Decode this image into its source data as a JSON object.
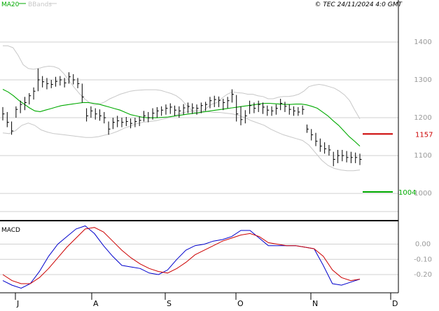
{
  "legend": {
    "ma20": "MA20",
    "bbands": "BBands"
  },
  "credit": "© TEC 24/11/2024 4:0 GMT",
  "colors": {
    "ma20": "#00aa00",
    "bbands": "#c8c8c8",
    "bars": "#000000",
    "grid": "#d0d0d0",
    "resistance": "#cc0000",
    "support": "#00aa00",
    "macd": "#0000cc",
    "signal": "#cc0000"
  },
  "chart_data": [
    {
      "type": "ohlc",
      "title": "",
      "legend": [
        "MA20",
        "BBands"
      ],
      "legend_placement": "top-left",
      "grid": true,
      "x_months": [
        "J",
        "A",
        "S",
        "O",
        "N",
        "D"
      ],
      "ylim": [
        930,
        1485
      ],
      "yticks": [
        1000,
        1100,
        1200,
        1300,
        1400
      ],
      "ytick_labels": [
        "1000",
        "1100",
        "1200",
        "1300",
        "1400"
      ],
      "levels": [
        {
          "name": "resistance",
          "value": 1157,
          "label": "1157"
        },
        {
          "name": "support",
          "value": 1004,
          "label": "1004"
        }
      ],
      "bars": [
        {
          "h": 1228,
          "l": 1193,
          "c": 1210
        },
        {
          "h": 1215,
          "l": 1175,
          "c": 1188
        },
        {
          "h": 1190,
          "l": 1155,
          "c": 1165
        },
        {
          "h": 1230,
          "l": 1200,
          "c": 1222
        },
        {
          "h": 1245,
          "l": 1212,
          "c": 1235
        },
        {
          "h": 1255,
          "l": 1220,
          "c": 1240
        },
        {
          "h": 1265,
          "l": 1235,
          "c": 1258
        },
        {
          "h": 1280,
          "l": 1248,
          "c": 1270
        },
        {
          "h": 1330,
          "l": 1270,
          "c": 1300
        },
        {
          "h": 1310,
          "l": 1280,
          "c": 1295
        },
        {
          "h": 1305,
          "l": 1275,
          "c": 1290
        },
        {
          "h": 1300,
          "l": 1278,
          "c": 1288
        },
        {
          "h": 1308,
          "l": 1282,
          "c": 1296
        },
        {
          "h": 1310,
          "l": 1285,
          "c": 1300
        },
        {
          "h": 1305,
          "l": 1280,
          "c": 1292
        },
        {
          "h": 1320,
          "l": 1290,
          "c": 1308
        },
        {
          "h": 1315,
          "l": 1288,
          "c": 1300
        },
        {
          "h": 1305,
          "l": 1278,
          "c": 1290
        },
        {
          "h": 1290,
          "l": 1240,
          "c": 1255
        },
        {
          "h": 1225,
          "l": 1190,
          "c": 1205
        },
        {
          "h": 1230,
          "l": 1200,
          "c": 1218
        },
        {
          "h": 1225,
          "l": 1195,
          "c": 1210
        },
        {
          "h": 1222,
          "l": 1192,
          "c": 1205
        },
        {
          "h": 1215,
          "l": 1185,
          "c": 1200
        },
        {
          "h": 1190,
          "l": 1155,
          "c": 1170
        },
        {
          "h": 1200,
          "l": 1170,
          "c": 1188
        },
        {
          "h": 1205,
          "l": 1175,
          "c": 1192
        },
        {
          "h": 1200,
          "l": 1175,
          "c": 1188
        },
        {
          "h": 1202,
          "l": 1178,
          "c": 1190
        },
        {
          "h": 1198,
          "l": 1172,
          "c": 1185
        },
        {
          "h": 1200,
          "l": 1175,
          "c": 1190
        },
        {
          "h": 1203,
          "l": 1178,
          "c": 1193
        },
        {
          "h": 1218,
          "l": 1190,
          "c": 1205
        },
        {
          "h": 1215,
          "l": 1188,
          "c": 1200
        },
        {
          "h": 1225,
          "l": 1195,
          "c": 1212
        },
        {
          "h": 1228,
          "l": 1200,
          "c": 1218
        },
        {
          "h": 1230,
          "l": 1205,
          "c": 1220
        },
        {
          "h": 1235,
          "l": 1208,
          "c": 1225
        },
        {
          "h": 1238,
          "l": 1210,
          "c": 1228
        },
        {
          "h": 1232,
          "l": 1205,
          "c": 1220
        },
        {
          "h": 1230,
          "l": 1200,
          "c": 1218
        },
        {
          "h": 1236,
          "l": 1208,
          "c": 1226
        },
        {
          "h": 1240,
          "l": 1212,
          "c": 1230
        },
        {
          "h": 1238,
          "l": 1210,
          "c": 1226
        },
        {
          "h": 1235,
          "l": 1208,
          "c": 1225
        },
        {
          "h": 1240,
          "l": 1212,
          "c": 1232
        },
        {
          "h": 1242,
          "l": 1218,
          "c": 1235
        },
        {
          "h": 1255,
          "l": 1225,
          "c": 1245
        },
        {
          "h": 1258,
          "l": 1228,
          "c": 1248
        },
        {
          "h": 1256,
          "l": 1228,
          "c": 1246
        },
        {
          "h": 1250,
          "l": 1220,
          "c": 1240
        },
        {
          "h": 1255,
          "l": 1225,
          "c": 1245
        },
        {
          "h": 1275,
          "l": 1240,
          "c": 1262
        },
        {
          "h": 1260,
          "l": 1190,
          "c": 1210
        },
        {
          "h": 1230,
          "l": 1180,
          "c": 1195
        },
        {
          "h": 1220,
          "l": 1185,
          "c": 1205
        },
        {
          "h": 1245,
          "l": 1210,
          "c": 1232
        },
        {
          "h": 1240,
          "l": 1212,
          "c": 1225
        },
        {
          "h": 1245,
          "l": 1215,
          "c": 1235
        },
        {
          "h": 1240,
          "l": 1210,
          "c": 1228
        },
        {
          "h": 1232,
          "l": 1205,
          "c": 1220
        },
        {
          "h": 1230,
          "l": 1205,
          "c": 1218
        },
        {
          "h": 1235,
          "l": 1208,
          "c": 1225
        },
        {
          "h": 1250,
          "l": 1220,
          "c": 1238
        },
        {
          "h": 1242,
          "l": 1215,
          "c": 1230
        },
        {
          "h": 1235,
          "l": 1208,
          "c": 1222
        },
        {
          "h": 1230,
          "l": 1205,
          "c": 1218
        },
        {
          "h": 1228,
          "l": 1205,
          "c": 1215
        },
        {
          "h": 1232,
          "l": 1208,
          "c": 1222
        },
        {
          "h": 1182,
          "l": 1160,
          "c": 1170
        },
        {
          "h": 1170,
          "l": 1140,
          "c": 1155
        },
        {
          "h": 1160,
          "l": 1125,
          "c": 1138
        },
        {
          "h": 1145,
          "l": 1110,
          "c": 1125
        },
        {
          "h": 1135,
          "l": 1105,
          "c": 1118
        },
        {
          "h": 1128,
          "l": 1100,
          "c": 1115
        },
        {
          "h": 1110,
          "l": 1072,
          "c": 1090
        },
        {
          "h": 1115,
          "l": 1080,
          "c": 1100
        },
        {
          "h": 1115,
          "l": 1085,
          "c": 1100
        },
        {
          "h": 1112,
          "l": 1082,
          "c": 1095
        },
        {
          "h": 1110,
          "l": 1080,
          "c": 1095
        },
        {
          "h": 1108,
          "l": 1080,
          "c": 1095
        },
        {
          "h": 1105,
          "l": 1075,
          "c": 1090
        }
      ],
      "ma20": [
        1275,
        1268,
        1258,
        1246,
        1236,
        1226,
        1218,
        1216,
        1220,
        1224,
        1228,
        1232,
        1234,
        1236,
        1238,
        1240,
        1240,
        1238,
        1236,
        1232,
        1228,
        1224,
        1220,
        1214,
        1208,
        1205,
        1202,
        1200,
        1200,
        1200,
        1201,
        1202,
        1204,
        1206,
        1208,
        1210,
        1212,
        1214,
        1216,
        1218,
        1220,
        1222,
        1224,
        1226,
        1228,
        1230,
        1232,
        1234,
        1236,
        1238,
        1238,
        1237,
        1236,
        1235,
        1235,
        1236,
        1236,
        1234,
        1230,
        1225,
        1215,
        1205,
        1192,
        1180,
        1165,
        1150,
        1138,
        1125
      ],
      "bb_upper": [
        1390,
        1390,
        1385,
        1365,
        1340,
        1330,
        1328,
        1330,
        1334,
        1336,
        1335,
        1330,
        1316,
        1298,
        1280,
        1264,
        1250,
        1240,
        1234,
        1236,
        1242,
        1250,
        1256,
        1262,
        1266,
        1270,
        1272,
        1273,
        1274,
        1274,
        1274,
        1272,
        1268,
        1264,
        1258,
        1248,
        1233,
        1220,
        1210,
        1214,
        1226,
        1236,
        1240,
        1252,
        1262,
        1268,
        1266,
        1265,
        1262,
        1262,
        1258,
        1256,
        1250,
        1250,
        1254,
        1256,
        1256,
        1258,
        1262,
        1270,
        1282,
        1286,
        1288,
        1286,
        1282,
        1278,
        1270,
        1260,
        1245,
        1220,
        1197
      ],
      "bb_lower": [
        1160,
        1158,
        1166,
        1180,
        1186,
        1180,
        1168,
        1162,
        1158,
        1156,
        1154,
        1152,
        1150,
        1148,
        1148,
        1150,
        1154,
        1158,
        1164,
        1172,
        1178,
        1184,
        1188,
        1190,
        1192,
        1196,
        1200,
        1206,
        1212,
        1216,
        1218,
        1218,
        1216,
        1214,
        1214,
        1212,
        1210,
        1206,
        1200,
        1192,
        1186,
        1180,
        1170,
        1162,
        1155,
        1150,
        1145,
        1140,
        1128,
        1108,
        1088,
        1074,
        1066,
        1062,
        1060,
        1060,
        1062
      ]
    },
    {
      "type": "line",
      "title": "MACD",
      "grid": true,
      "ylim": [
        -32,
        15
      ],
      "yticks": [
        0,
        -10,
        -20
      ],
      "ytick_labels": [
        "0.00",
        "-0.10",
        "-0.20"
      ],
      "series": [
        {
          "name": "MACD",
          "values": [
            -24,
            -27,
            -29,
            -26,
            -18,
            -8,
            0,
            5,
            10,
            12,
            7,
            -1,
            -8,
            -14,
            -15,
            -16,
            -19,
            -20,
            -17,
            -10,
            -4,
            -1,
            0,
            2,
            3,
            5,
            9,
            9,
            4,
            -1,
            -1,
            -1,
            -1,
            -2,
            -3,
            -14,
            -26,
            -27,
            -25,
            -23
          ]
        },
        {
          "name": "Signal",
          "values": [
            -20,
            -24,
            -26,
            -26,
            -22,
            -16,
            -9,
            -2,
            4,
            10,
            11,
            8,
            2,
            -4,
            -9,
            -13,
            -16,
            -18,
            -19,
            -16,
            -12,
            -7,
            -4,
            -1,
            2,
            4,
            6,
            7,
            5,
            1,
            0,
            -1,
            -1,
            -2,
            -3,
            -8,
            -17,
            -22,
            -24,
            -23
          ]
        }
      ]
    }
  ]
}
